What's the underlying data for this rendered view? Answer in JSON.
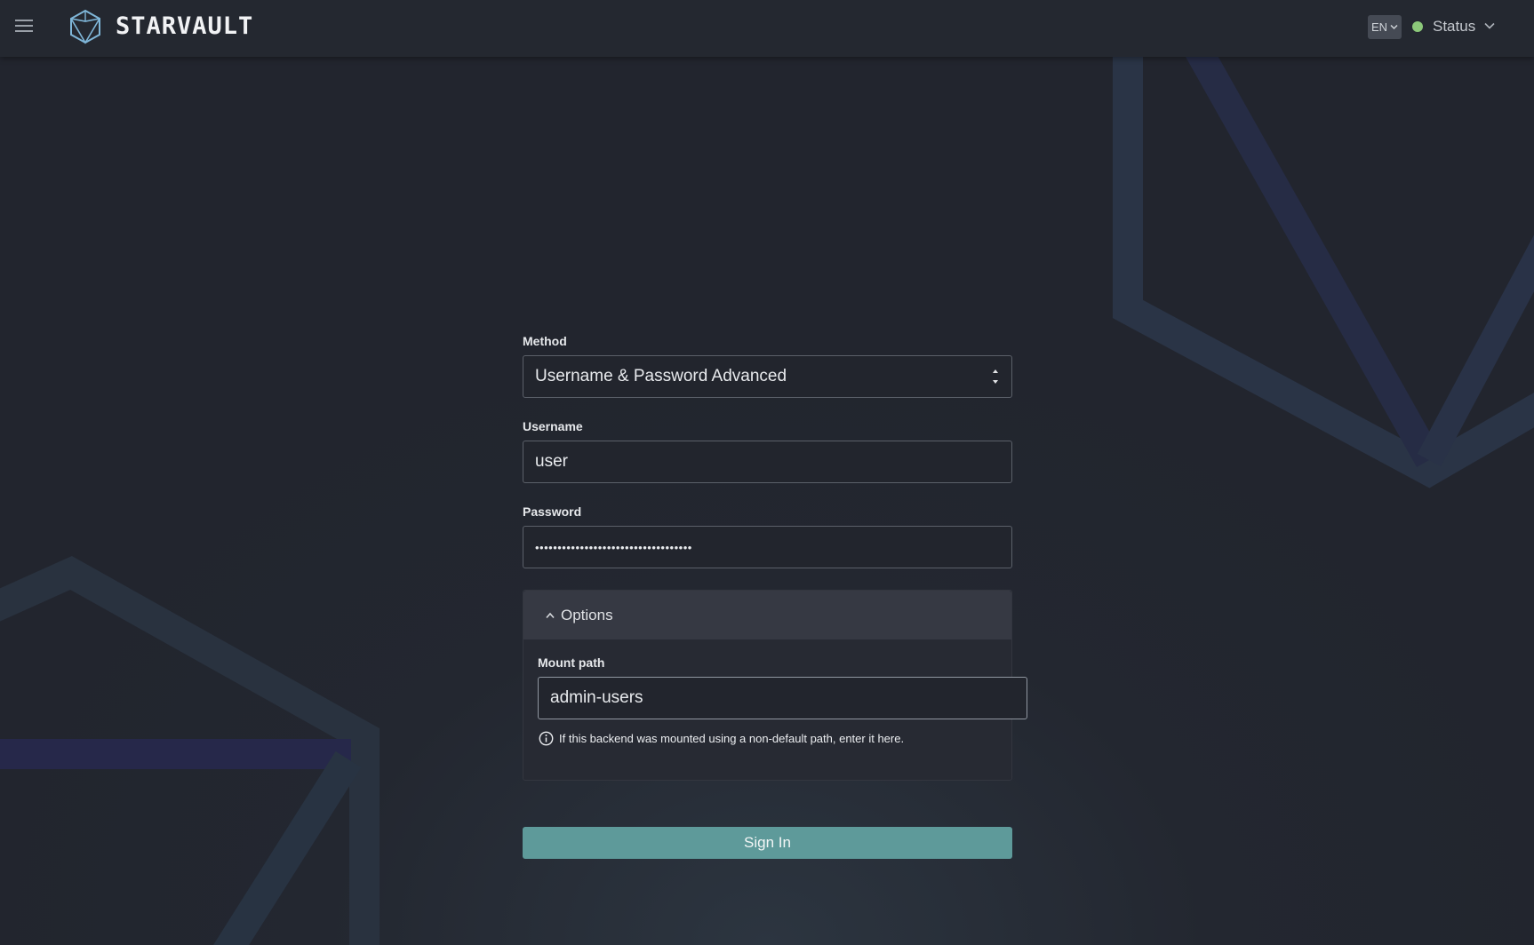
{
  "header": {
    "menu_icon": "hamburger-menu-icon",
    "logo_icon": "polyhedron-logo-icon",
    "brand": "STARVAULT",
    "language": "EN",
    "status_label": "Status",
    "status_color": "#8cc97a"
  },
  "login": {
    "method_label": "Method",
    "method_value": "Username & Password Advanced",
    "username_label": "Username",
    "username_value": "user",
    "password_label": "Password",
    "password_value": "•••••••••••••••••••••••••••••••••••",
    "options": {
      "toggle_label": "Options",
      "expanded": true,
      "mount_path_label": "Mount path",
      "mount_path_value": "admin-users",
      "helper_text": "If this backend was mounted using a non-default path, enter it here."
    },
    "submit_label": "Sign In",
    "submit_color": "#5e9a9a"
  },
  "theme": {
    "background": "#22252e",
    "header": "#242830",
    "input_border": "#5b6069",
    "decor_line": "#2b3a4e"
  }
}
